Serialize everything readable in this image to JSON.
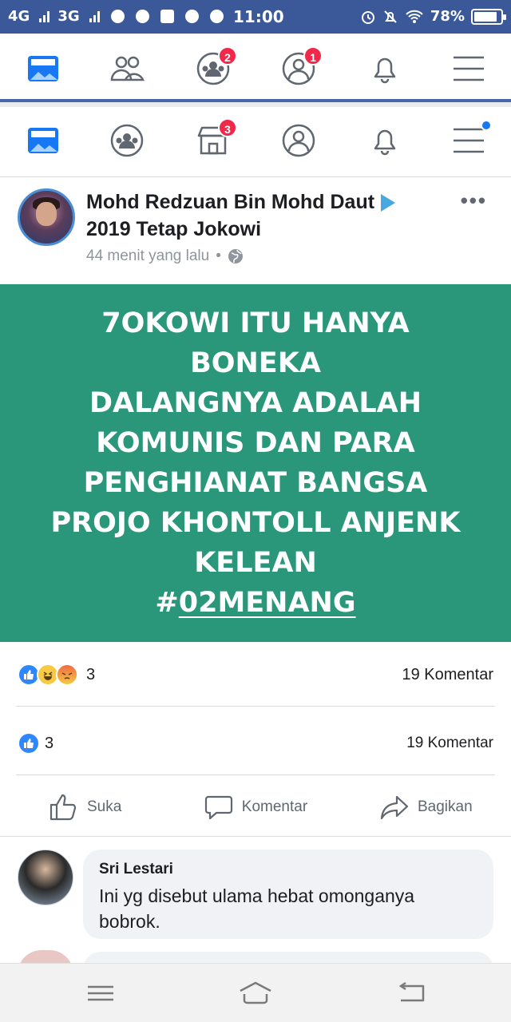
{
  "status_bar": {
    "network1": "4G",
    "network2": "3G",
    "time": "11:00",
    "battery": "78%",
    "battery_level": 0.78
  },
  "nav_top": {
    "items": [
      {
        "name": "news-feed",
        "badge": ""
      },
      {
        "name": "friends",
        "badge": ""
      },
      {
        "name": "groups",
        "badge": "2"
      },
      {
        "name": "profile",
        "badge": "1"
      },
      {
        "name": "notifications",
        "badge": ""
      },
      {
        "name": "menu",
        "badge": ""
      }
    ]
  },
  "nav_second": {
    "items": [
      {
        "name": "news-feed",
        "badge": ""
      },
      {
        "name": "groups",
        "badge": ""
      },
      {
        "name": "marketplace",
        "badge": "3"
      },
      {
        "name": "profile",
        "badge": ""
      },
      {
        "name": "notifications",
        "badge": ""
      },
      {
        "name": "menu",
        "badge": "dot"
      }
    ]
  },
  "post": {
    "author": "Mohd Redzuan Bin Mohd Daut",
    "shared_to": "2019 Tetap Jokowi",
    "time": "44 menit yang lalu",
    "more": "•••",
    "body_lines": [
      "7OKOWI ITU HANYA BONEKA",
      "DALANGNYA ADALAH",
      "KOMUNIS DAN PARA",
      "PENGHIANAT BANGSA",
      "PROJO KHONTOLL ANJENK",
      "KELEAN"
    ],
    "hashtag_prefix": "#",
    "hashtag": "02MENANG",
    "background_color": "#2a977a"
  },
  "reactions_row1": {
    "count": "3",
    "comments": "19 Komentar"
  },
  "reactions_row2": {
    "count": "3",
    "comments": "19 Komentar"
  },
  "actions": {
    "like": "Suka",
    "comment": "Komentar",
    "share": "Bagikan"
  },
  "comment": {
    "name": "Sri Lestari",
    "text": "Ini yg disebut ulama  hebat omonganya bobrok."
  },
  "colors": {
    "brand": "#3b5998",
    "badge": "#f02849",
    "like": "#2d88ff"
  }
}
